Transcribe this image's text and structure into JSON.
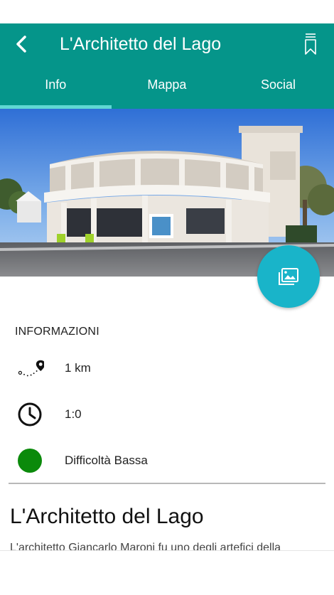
{
  "header": {
    "title": "L'Architetto del Lago",
    "back_icon": "chevron-left-icon",
    "bookmark_icon": "bookmark-icon",
    "color": "#05958a"
  },
  "tabs": [
    {
      "label": "Info",
      "active": true
    },
    {
      "label": "Mappa",
      "active": false
    },
    {
      "label": "Social",
      "active": false
    }
  ],
  "gallery_button": {
    "icon": "image-gallery-icon",
    "color": "#19b4c9"
  },
  "info": {
    "heading": "INFORMAZIONI",
    "distance": "1 km",
    "duration": "1:0",
    "difficulty": "Difficoltà Bassa",
    "difficulty_color": "#0b8a0b"
  },
  "detail": {
    "title": "L'Architetto del Lago",
    "text": "L'architetto Giancarlo Maroni fu uno degli artefici della"
  }
}
